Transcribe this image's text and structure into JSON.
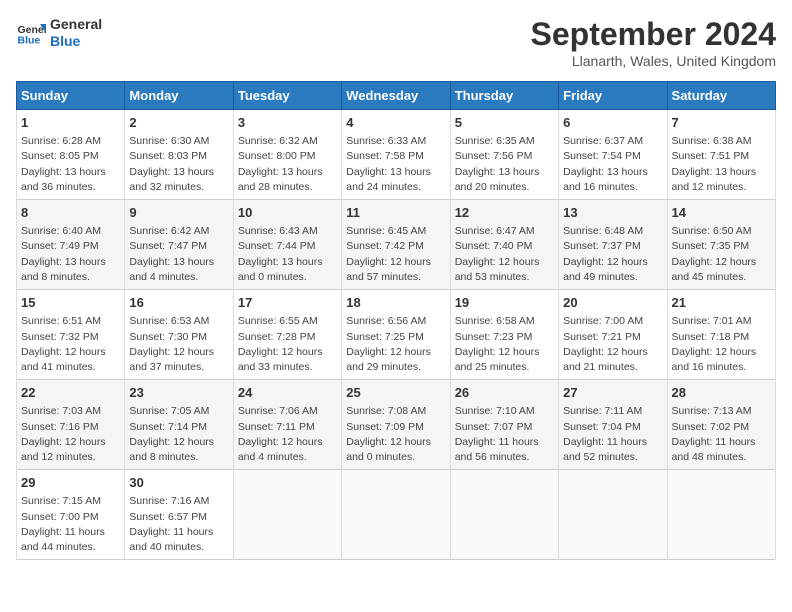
{
  "logo": {
    "line1": "General",
    "line2": "Blue"
  },
  "title": "September 2024",
  "location": "Llanarth, Wales, United Kingdom",
  "headers": [
    "Sunday",
    "Monday",
    "Tuesday",
    "Wednesday",
    "Thursday",
    "Friday",
    "Saturday"
  ],
  "weeks": [
    [
      {
        "day": "1",
        "sunrise": "6:28 AM",
        "sunset": "8:05 PM",
        "daylight": "13 hours and 36 minutes."
      },
      {
        "day": "2",
        "sunrise": "6:30 AM",
        "sunset": "8:03 PM",
        "daylight": "13 hours and 32 minutes."
      },
      {
        "day": "3",
        "sunrise": "6:32 AM",
        "sunset": "8:00 PM",
        "daylight": "13 hours and 28 minutes."
      },
      {
        "day": "4",
        "sunrise": "6:33 AM",
        "sunset": "7:58 PM",
        "daylight": "13 hours and 24 minutes."
      },
      {
        "day": "5",
        "sunrise": "6:35 AM",
        "sunset": "7:56 PM",
        "daylight": "13 hours and 20 minutes."
      },
      {
        "day": "6",
        "sunrise": "6:37 AM",
        "sunset": "7:54 PM",
        "daylight": "13 hours and 16 minutes."
      },
      {
        "day": "7",
        "sunrise": "6:38 AM",
        "sunset": "7:51 PM",
        "daylight": "13 hours and 12 minutes."
      }
    ],
    [
      {
        "day": "8",
        "sunrise": "6:40 AM",
        "sunset": "7:49 PM",
        "daylight": "13 hours and 8 minutes."
      },
      {
        "day": "9",
        "sunrise": "6:42 AM",
        "sunset": "7:47 PM",
        "daylight": "13 hours and 4 minutes."
      },
      {
        "day": "10",
        "sunrise": "6:43 AM",
        "sunset": "7:44 PM",
        "daylight": "13 hours and 0 minutes."
      },
      {
        "day": "11",
        "sunrise": "6:45 AM",
        "sunset": "7:42 PM",
        "daylight": "12 hours and 57 minutes."
      },
      {
        "day": "12",
        "sunrise": "6:47 AM",
        "sunset": "7:40 PM",
        "daylight": "12 hours and 53 minutes."
      },
      {
        "day": "13",
        "sunrise": "6:48 AM",
        "sunset": "7:37 PM",
        "daylight": "12 hours and 49 minutes."
      },
      {
        "day": "14",
        "sunrise": "6:50 AM",
        "sunset": "7:35 PM",
        "daylight": "12 hours and 45 minutes."
      }
    ],
    [
      {
        "day": "15",
        "sunrise": "6:51 AM",
        "sunset": "7:32 PM",
        "daylight": "12 hours and 41 minutes."
      },
      {
        "day": "16",
        "sunrise": "6:53 AM",
        "sunset": "7:30 PM",
        "daylight": "12 hours and 37 minutes."
      },
      {
        "day": "17",
        "sunrise": "6:55 AM",
        "sunset": "7:28 PM",
        "daylight": "12 hours and 33 minutes."
      },
      {
        "day": "18",
        "sunrise": "6:56 AM",
        "sunset": "7:25 PM",
        "daylight": "12 hours and 29 minutes."
      },
      {
        "day": "19",
        "sunrise": "6:58 AM",
        "sunset": "7:23 PM",
        "daylight": "12 hours and 25 minutes."
      },
      {
        "day": "20",
        "sunrise": "7:00 AM",
        "sunset": "7:21 PM",
        "daylight": "12 hours and 21 minutes."
      },
      {
        "day": "21",
        "sunrise": "7:01 AM",
        "sunset": "7:18 PM",
        "daylight": "12 hours and 16 minutes."
      }
    ],
    [
      {
        "day": "22",
        "sunrise": "7:03 AM",
        "sunset": "7:16 PM",
        "daylight": "12 hours and 12 minutes."
      },
      {
        "day": "23",
        "sunrise": "7:05 AM",
        "sunset": "7:14 PM",
        "daylight": "12 hours and 8 minutes."
      },
      {
        "day": "24",
        "sunrise": "7:06 AM",
        "sunset": "7:11 PM",
        "daylight": "12 hours and 4 minutes."
      },
      {
        "day": "25",
        "sunrise": "7:08 AM",
        "sunset": "7:09 PM",
        "daylight": "12 hours and 0 minutes."
      },
      {
        "day": "26",
        "sunrise": "7:10 AM",
        "sunset": "7:07 PM",
        "daylight": "11 hours and 56 minutes."
      },
      {
        "day": "27",
        "sunrise": "7:11 AM",
        "sunset": "7:04 PM",
        "daylight": "11 hours and 52 minutes."
      },
      {
        "day": "28",
        "sunrise": "7:13 AM",
        "sunset": "7:02 PM",
        "daylight": "11 hours and 48 minutes."
      }
    ],
    [
      {
        "day": "29",
        "sunrise": "7:15 AM",
        "sunset": "7:00 PM",
        "daylight": "11 hours and 44 minutes."
      },
      {
        "day": "30",
        "sunrise": "7:16 AM",
        "sunset": "6:57 PM",
        "daylight": "11 hours and 40 minutes."
      },
      null,
      null,
      null,
      null,
      null
    ]
  ]
}
